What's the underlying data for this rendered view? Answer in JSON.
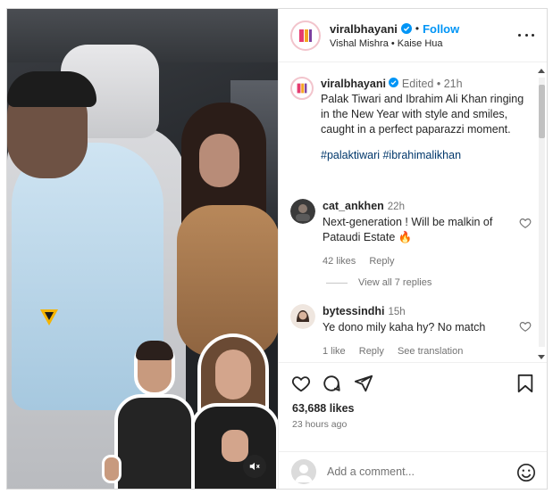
{
  "colors": {
    "link_blue": "#0095f6",
    "hashtag_blue": "#00376b",
    "text": "#262626",
    "muted": "#737373",
    "border": "#dbdbdb"
  },
  "post": {
    "author": "viralbhayani",
    "verified": true,
    "follow_label": "Follow",
    "separator": "•",
    "audio": "Vishal Mishra • Kaise Hua",
    "more_icon": "more-horizontal-icon"
  },
  "caption": {
    "username": "viralbhayani",
    "edited": "Edited",
    "separator": "•",
    "time": "21h",
    "text": "Palak Tiwari and Ibrahim Ali Khan ringing in the New Year with style and smiles, caught in a perfect paparazzi moment.",
    "hashtags": "#palaktiwari #ibrahimalikhan"
  },
  "comments": [
    {
      "username": "cat_ankhen",
      "time": "22h",
      "text": "Next-generation ! Will be malkin of Pataudi Estate 🔥",
      "likes": "42 likes",
      "reply_label": "Reply",
      "view_replies": "View all 7 replies"
    },
    {
      "username": "bytessindhi",
      "time": "15h",
      "text": "Ye dono mily kaha hy? No match",
      "likes": "1 like",
      "reply_label": "Reply",
      "translation_label": "See translation"
    }
  ],
  "actions": {
    "like_icon": "heart-icon",
    "comment_icon": "comment-icon",
    "share_icon": "share-icon",
    "save_icon": "bookmark-icon"
  },
  "likes": "63,688 likes",
  "posted_ago": "23 hours ago",
  "add_comment": {
    "placeholder": "Add a comment...",
    "emoji_icon": "emoji-icon"
  },
  "media": {
    "mute_icon": "speaker-muted-icon",
    "watermark_icon": "v-logo-icon"
  }
}
